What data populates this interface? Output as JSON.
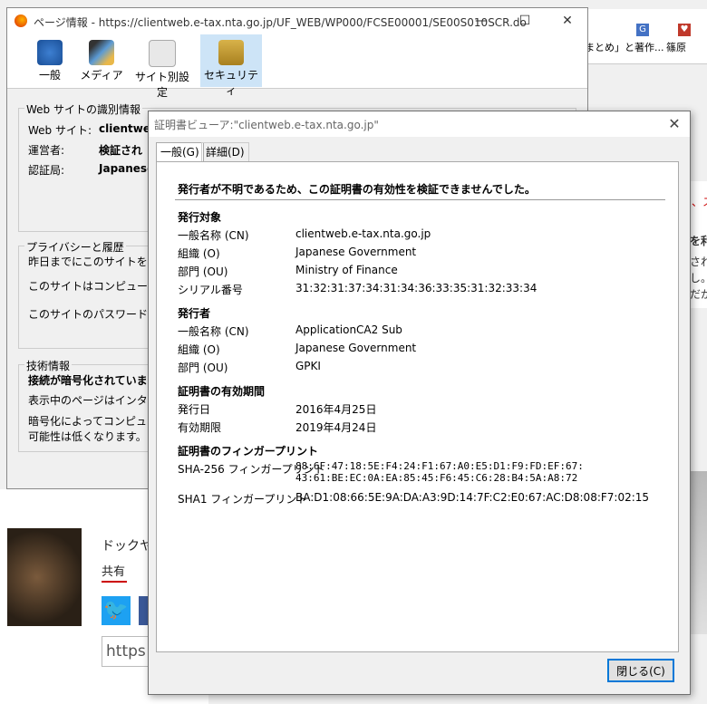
{
  "background": {
    "tabs": [
      "まとめ」と著作...",
      "篠原"
    ],
    "right_texts": [
      "、ス",
      "を利",
      "され",
      "し。開",
      "だが"
    ],
    "page_title": "ドックヤ",
    "share_label": "共有",
    "twitter_icon": "twitter-icon",
    "url_input": "https"
  },
  "page_info": {
    "title": "ページ情報 - https://clientweb.e-tax.nta.go.jp/UF_WEB/WP000/FCSE00001/SE00S010SCR.do",
    "tabs": [
      {
        "label": "一般",
        "icon": "info-icon"
      },
      {
        "label": "メディア",
        "icon": "media-icon"
      },
      {
        "label": "サイト別設定",
        "icon": "settings-icon"
      },
      {
        "label": "セキュリティ",
        "icon": "lock-icon"
      }
    ],
    "identity": {
      "header": "Web サイトの識別情報",
      "website_label": "Web サイト:",
      "website_value": "clientweb.",
      "owner_label": "運営者:",
      "owner_value": "検証され",
      "verifier_label": "認証局:",
      "verifier_value": "Japanese"
    },
    "privacy": {
      "header": "プライバシーと履歴",
      "q1": "昨日までにこのサイトを表示",
      "q2": "このサイトはコンピュータに情報",
      "q3": "このサイトのパスワードを保存"
    },
    "technical": {
      "header": "技術情報",
      "line1": "接続が暗号化されています",
      "line2": "表示中のページはインターネッ",
      "line3": "暗号化によってコンピュータ間",
      "line4": "可能性は低くなります。"
    }
  },
  "cert_viewer": {
    "title": "証明書ビューア:\"clientweb.e-tax.nta.go.jp\"",
    "tab_general": "一般(G)",
    "tab_details": "詳細(D)",
    "warning": "発行者が不明であるため、この証明書の有効性を検証できませんでした。",
    "subject": {
      "header": "発行対象",
      "cn_label": "一般名称 (CN)",
      "cn": "clientweb.e-tax.nta.go.jp",
      "o_label": "組織 (O)",
      "o": "Japanese Government",
      "ou_label": "部門 (OU)",
      "ou": "Ministry of Finance",
      "serial_label": "シリアル番号",
      "serial": "31:32:31:37:34:31:34:36:33:35:31:32:33:34"
    },
    "issuer": {
      "header": "発行者",
      "cn_label": "一般名称 (CN)",
      "cn": "ApplicationCA2 Sub",
      "o_label": "組織 (O)",
      "o": "Japanese Government",
      "ou_label": "部門 (OU)",
      "ou": "GPKI"
    },
    "validity": {
      "header": "証明書の有効期間",
      "issued_label": "発行日",
      "issued": "2016年4月25日",
      "expires_label": "有効期限",
      "expires": "2019年4月24日"
    },
    "fingerprints": {
      "header": "証明書のフィンガープリント",
      "sha256_label": "SHA-256 フィンガープリント",
      "sha256_line1": "88:6F:47:18:5E:F4:24:F1:67:A0:E5:D1:F9:FD:EF:67:",
      "sha256_line2": "43:61:BE:EC:0A:EA:85:45:F6:45:C6:28:B4:5A:A8:72",
      "sha1_label": "SHA1 フィンガープリント",
      "sha1": "BA:D1:08:66:5E:9A:DA:A3:9D:14:7F:C2:E0:67:AC:D8:08:F7:02:15"
    },
    "close_button": "閉じる(C)"
  }
}
